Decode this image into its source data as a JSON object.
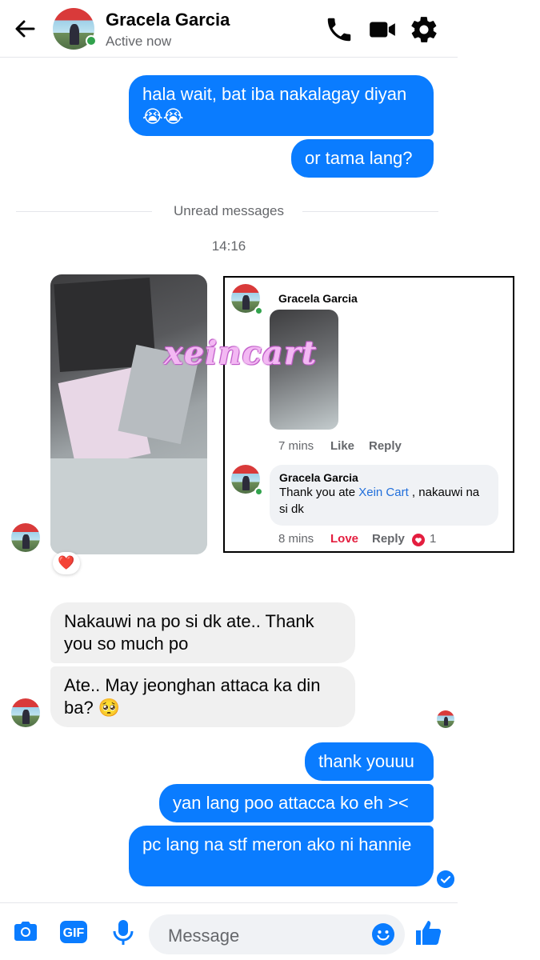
{
  "header": {
    "name": "Gracela Garcia",
    "status": "Active now"
  },
  "messages": {
    "out_1": "hala wait, bat iba nakalagay diyan 😭😭",
    "out_2": "or tama lang?",
    "unread_label": "Unread messages",
    "timestamp": "14:16",
    "photo_reaction": "❤️",
    "in_1": "Nakauwi na po si dk ate.. Thank you so much po",
    "in_2": "Ate.. May jeonghan attaca ka din ba? 🥺",
    "out_3": "thank youuu",
    "out_4": "yan lang poo attacca ko eh ><",
    "out_5": "pc lang na stf meron ako ni hannie"
  },
  "shared_screenshot": {
    "watermark": "xeincart",
    "post_author": "Gracela Garcia",
    "post_time": "7 mins",
    "post_like": "Like",
    "post_reply": "Reply",
    "comment_author": "Gracela Garcia",
    "comment_text_before": "Thank you ate ",
    "comment_mention": "Xein Cart",
    "comment_text_after": " , nakauwi na si dk",
    "comment_time": "8 mins",
    "comment_love": "Love",
    "comment_reply": "Reply",
    "comment_reaction_count": "1"
  },
  "composer": {
    "placeholder": "Message"
  },
  "colors": {
    "accent": "#0a7cff",
    "online": "#31a24c"
  }
}
